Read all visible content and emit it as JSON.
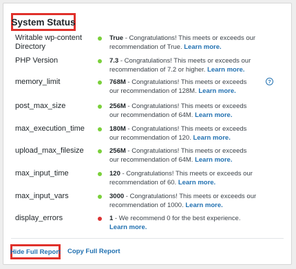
{
  "panel": {
    "title": "System Status"
  },
  "rows": [
    {
      "label": "Writable wp-content Directory",
      "status": "ok",
      "value": "True",
      "message": " - Congratulations! This meets or exceeds our recommendation of True. ",
      "link": "Learn more."
    },
    {
      "label": "PHP Version",
      "status": "ok",
      "value": "7.3",
      "message": " - Congratulations! This meets or exceeds our recommendation of 7.2 or higher. ",
      "link": "Learn more."
    },
    {
      "label": "memory_limit",
      "status": "ok",
      "value": "768M",
      "message": " - Congratulations! This meets or exceeds our recommendation of 128M. ",
      "link": "Learn more."
    },
    {
      "label": "post_max_size",
      "status": "ok",
      "value": "256M",
      "message": " - Congratulations! This meets or exceeds our recommendation of 64M. ",
      "link": "Learn more."
    },
    {
      "label": "max_execution_time",
      "status": "ok",
      "value": "180M",
      "message": " - Congratulations! This meets or exceeds our recommendation of 120. ",
      "link": "Learn more."
    },
    {
      "label": "upload_max_filesize",
      "status": "ok",
      "value": "256M",
      "message": " - Congratulations! This meets or exceeds our recommendation of 64M. ",
      "link": "Learn more."
    },
    {
      "label": "max_input_time",
      "status": "ok",
      "value": "120",
      "message": " - Congratulations! This meets or exceeds our recommendation of 60. ",
      "link": "Learn more."
    },
    {
      "label": "max_input_vars",
      "status": "ok",
      "value": "3000",
      "message": " - Congratulations! This meets or exceeds our recommendation of 1000. ",
      "link": "Learn more."
    },
    {
      "label": "display_errors",
      "status": "error",
      "value": "1",
      "message": " - We recommend 0 for the best experience. ",
      "link": "Learn more."
    }
  ],
  "help_icon": {
    "icon": "question-circle-icon",
    "glyph": "?"
  },
  "colors": {
    "ok": "#7ad03a",
    "error": "#dc3232",
    "link": "#2271b1",
    "highlight": "#e0302a"
  },
  "footer": {
    "hide_label": "Hide Full Report",
    "copy_label": "Copy Full Report"
  }
}
